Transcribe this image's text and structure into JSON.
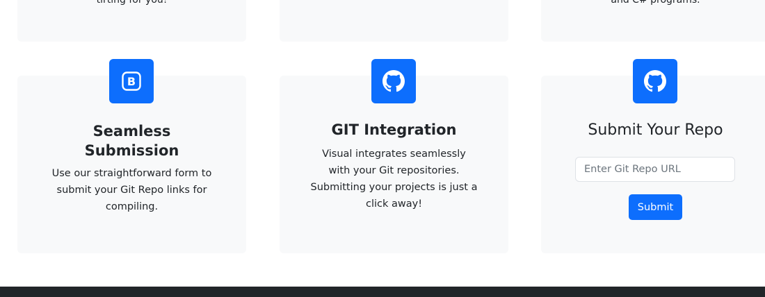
{
  "top_cards": [
    {
      "text": "tirting for you!"
    },
    {
      "text": ""
    },
    {
      "text": "and C# programs."
    }
  ],
  "feature_cards": [
    {
      "icon": "bootstrap-icon",
      "title_line1": "Seamless",
      "title_line2": "Submission",
      "text_lines": [
        "Use our straightforward form to",
        "submit your Git Repo links for",
        "compiling."
      ]
    },
    {
      "icon": "github-icon",
      "title": "GIT Integration",
      "text_lines": [
        "Visual integrates seamlessly",
        "with your Git repositories.",
        "Submitting your projects is just a",
        "click away!"
      ]
    }
  ],
  "repo_form": {
    "icon": "github-icon",
    "title": "Submit Your Repo",
    "input_placeholder": "Enter Git Repo URL",
    "input_value": "",
    "submit_label": "Submit"
  },
  "colors": {
    "accent": "#0d6efd",
    "card_bg": "#f8f9fa",
    "footer_bg": "#212529",
    "text": "#212529"
  }
}
